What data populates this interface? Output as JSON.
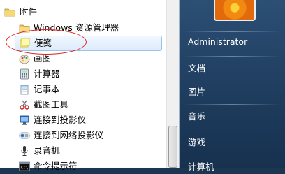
{
  "menu": {
    "folder": {
      "label": "附件",
      "icon": "folder-icon"
    },
    "items": [
      {
        "label": "Windows 资源管理器",
        "icon": "folder-explorer-icon"
      },
      {
        "label": "便笺",
        "icon": "sticky-notes-icon"
      },
      {
        "label": "画图",
        "icon": "paint-icon"
      },
      {
        "label": "计算器",
        "icon": "calculator-icon"
      },
      {
        "label": "记事本",
        "icon": "notepad-icon"
      },
      {
        "label": "截图工具",
        "icon": "snipping-tool-icon"
      },
      {
        "label": "连接到投影仪",
        "icon": "projector-icon"
      },
      {
        "label": "连接到网络投影仪",
        "icon": "network-projector-icon"
      },
      {
        "label": "录音机",
        "icon": "microphone-icon"
      },
      {
        "label": "命令提示符",
        "icon": "command-prompt-icon"
      }
    ]
  },
  "right_pane": {
    "items": [
      {
        "label": "Administrator"
      },
      {
        "label": "文档"
      },
      {
        "label": "图片"
      },
      {
        "label": "音乐"
      },
      {
        "label": "游戏"
      },
      {
        "label": "计算机"
      }
    ]
  },
  "colors": {
    "highlight_border": "#99c4ea",
    "annotation_circle": "#e02020",
    "right_pane": "#2c4f74"
  }
}
